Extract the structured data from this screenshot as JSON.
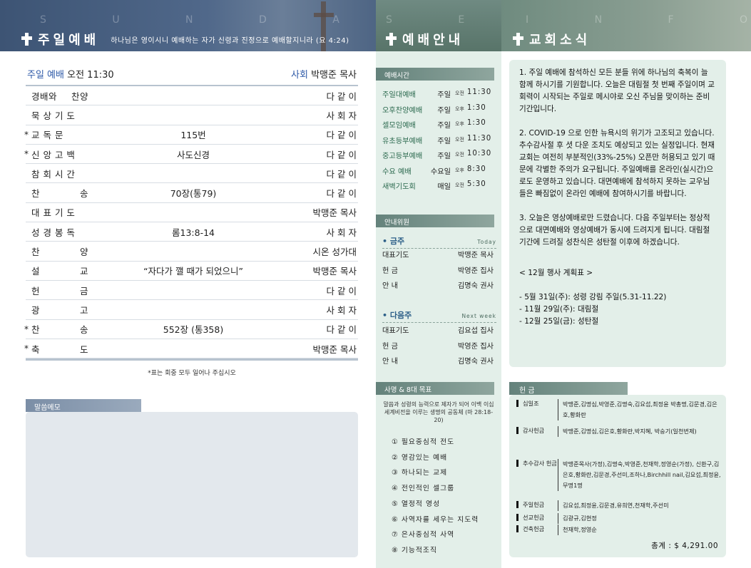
{
  "header": {
    "left": {
      "watermark": "S U N D A Y   S E R V I C E",
      "title": "주일예배",
      "verse": "하나님은 영이시니 예배하는 자가 신령과 진정으로 예배할지니라 (요 4:24)"
    },
    "middle": {
      "watermark": "S E R V I C E",
      "title": "예배안내"
    },
    "right": {
      "watermark": "I N F O R M A T I O N",
      "title": "교회소식"
    }
  },
  "service": {
    "label": "주일 예배",
    "time": "오전 11:30",
    "leader_label": "사회",
    "leader": "박맹준 목사",
    "order": [
      {
        "mark": "",
        "name": "경배와 찬양",
        "content": "",
        "person": "다 같 이"
      },
      {
        "mark": "",
        "name": "묵 상 기 도",
        "content": "",
        "person": "사 회 자"
      },
      {
        "mark": "*",
        "name": "교 독 문",
        "content": "115번",
        "person": "다 같 이"
      },
      {
        "mark": "*",
        "name": "신 앙 고 백",
        "content": "사도신경",
        "person": "다 같 이"
      },
      {
        "mark": "",
        "name": "참 회 시 간",
        "content": "",
        "person": "다 같 이"
      },
      {
        "mark": "",
        "name": "찬 송",
        "content": "70장(통79)",
        "person": "다 같 이"
      },
      {
        "mark": "",
        "name": "대 표 기 도",
        "content": "",
        "person": "박맹준 목사"
      },
      {
        "mark": "",
        "name": "성 경 봉 독",
        "content": "롬13:8-14",
        "person": "사 회 자"
      },
      {
        "mark": "",
        "name": "찬 양",
        "content": "",
        "person": "시온 성가대"
      },
      {
        "mark": "",
        "name": "설 교",
        "content": "“자다가 깰 때가 되었으니”",
        "person": "박맹준 목사"
      },
      {
        "mark": "",
        "name": "헌 금",
        "content": "",
        "person": "다 같 이"
      },
      {
        "mark": "",
        "name": "광 고",
        "content": "",
        "person": "사 회 자"
      },
      {
        "mark": "*",
        "name": "찬 송",
        "content": "552장 (통358)",
        "person": "다 같 이"
      },
      {
        "mark": "*",
        "name": "축 도",
        "content": "",
        "person": "박맹준 목사"
      }
    ],
    "note": "*표는 회중 모두 일어나 주십시오"
  },
  "memo": {
    "label": "말씀메모"
  },
  "schedule": {
    "label": "예배시간",
    "items": [
      {
        "name": "주일대예배",
        "day": "주일",
        "ampm": "오전",
        "time": "11:30"
      },
      {
        "name": "오후찬양예배",
        "day": "주일",
        "ampm": "오후",
        "time": "1:30"
      },
      {
        "name": "셀모임예배",
        "day": "주일",
        "ampm": "오후",
        "time": "1:30"
      },
      {
        "name": "유초등부예배",
        "day": "주일",
        "ampm": "오전",
        "time": "11:30"
      },
      {
        "name": "중고등부예배",
        "day": "주일",
        "ampm": "오전",
        "time": "10:30"
      },
      {
        "name": "수요 예배",
        "day": "수요일",
        "ampm": "오후",
        "time": "8:30"
      },
      {
        "name": "새벽기도회",
        "day": "매일",
        "ampm": "오전",
        "time": "5:30"
      }
    ]
  },
  "ushers": {
    "label": "안내위원",
    "this_week": {
      "title": "• 금주",
      "eng": "Today",
      "rows": [
        {
          "role": "대표기도",
          "person": "박맹준 목사"
        },
        {
          "role": "헌 금",
          "person": "박영준 집사"
        },
        {
          "role": "안 내",
          "person": "김명숙 권사"
        }
      ]
    },
    "next_week": {
      "title": "• 다음주",
      "eng": "Next week",
      "rows": [
        {
          "role": "대표기도",
          "person": "김요섭 집사"
        },
        {
          "role": "헌 금",
          "person": "박영준 집사"
        },
        {
          "role": "안 내",
          "person": "김명숙 권사"
        }
      ]
    }
  },
  "mission": {
    "label": "사명 & 8대 목표",
    "text": "말씀과 성령의 능력으로 제자가 되어 이백 이십 세계비전을 이루는 생명의 공동체 (마 28:18-20)",
    "goals": [
      "① 필요중심적 전도",
      "② 영감있는 예배",
      "③ 하나되는 교제",
      "④ 전인적인 셀그룹",
      "⑤ 열정적 영성",
      "⑥ 사역자를 세우는 지도력",
      "⑦ 은사중심적 사역",
      "⑧ 기능적조직"
    ]
  },
  "news": {
    "items": [
      "1. 주일 예배에 참석하신 모든 분들 위에 하나님의 축복이 늘 함께 하시기를 기원합니다. 오늘은 대림절 첫 번째 주일이며 교회력이 시작되는 주일로 메시야로 오신 주님을 맞이하는 준비기간입니다.",
      "2. COVID-19 으로 인한 뉴욕시의 위기가 고조되고 있습니다. 추수감사절 후 셧 다운 조치도 예상되고 있는 실정입니다. 현재 교회는 여전히 부분적인(33%-25%) 오픈만 허용되고 있기 때문에 각별한 주의가 요구됩니다. 주일예배를 온라인(실시간)으로도 운영하고 있습니다. 대면예배에 참석하지 못하는 교우님들은 빠짐없이 온라인 예배에 참여하시기를 바랍니다.",
      "3. 오늘은 영상예배로만 드렸습니다. 다음 주일부터는 정상적으로 대면예배와 영상예배가 동시에 드려지게 됩니다. 대림절 기간에 드려질 성찬식은 성탄절 이후에 하겠습니다."
    ],
    "events_title": "< 12월 행사 계획표 >",
    "events": [
      "- 5월 31일(주): 성령 강림 주일(5.31-11.22)",
      "- 11월 29일(주): 대림절",
      "- 12월 25일(금): 성탄절"
    ]
  },
  "offering": {
    "label": "헌 금",
    "rows": [
      {
        "type": "십일조",
        "names": "박맹준,김명심,박영준,김명숙,김요섭,최정윤 박총명,김문경,김은호,황화란"
      },
      {
        "type": "감사헌금",
        "names": "박맹준,김명심,김은호,황화란,박지혜, 박숭기(일천번제)"
      },
      {
        "type": "추수감사 헌금",
        "names": "박맹준목사(가정),김명숙,박영준,천재학,정영순(가정), 신환구,김은호,황화란,김문경,주선미,조하나,Birchhill nail,김요섭,최정윤,무명1명"
      },
      {
        "type": "주일헌금",
        "names": "김요섭,최정윤,김문경,유희연,천재학,주선미"
      },
      {
        "type": "선교헌금",
        "names": "김광규,김현정"
      },
      {
        "type": "건축헌금",
        "names": "천재학,정영순"
      }
    ],
    "total_label": "총계 :",
    "total": "$ 4,291.00"
  }
}
